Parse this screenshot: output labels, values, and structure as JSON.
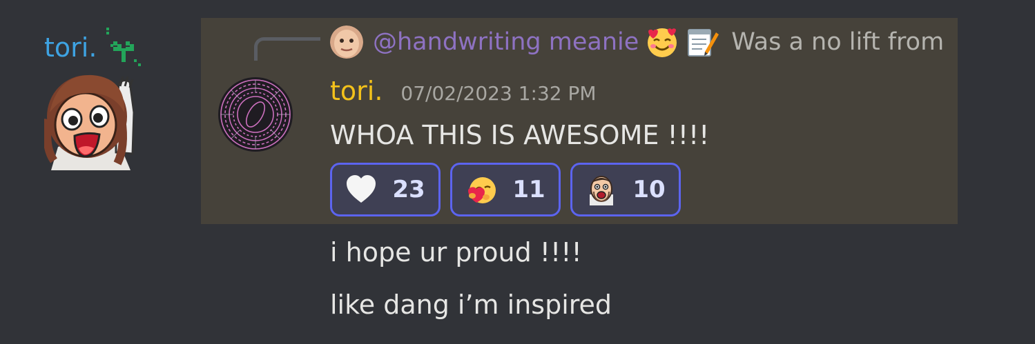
{
  "author": {
    "name": "tori."
  },
  "reply": {
    "mention": "@handwriting meanie",
    "preview": "Was a no lift from"
  },
  "message": {
    "author": "tori.",
    "timestamp": "07/02/2023 1:32 PM",
    "text": "WHOA THIS IS AWESOME !!!!",
    "reactions": [
      {
        "icon": "white-heart-icon",
        "count": "23"
      },
      {
        "icon": "heart-hug-icon",
        "count": "11"
      },
      {
        "icon": "shocked-face-icon",
        "count": "10"
      }
    ]
  },
  "followups": [
    "i hope ur proud !!!!",
    "like dang i’m inspired"
  ],
  "colors": {
    "background": "#313338",
    "highlight": "#46423a",
    "author_blue": "#3ea3e2",
    "author_gold": "#f3c11b",
    "mention": "#8e72c2",
    "reaction_border": "#5c64f0"
  }
}
